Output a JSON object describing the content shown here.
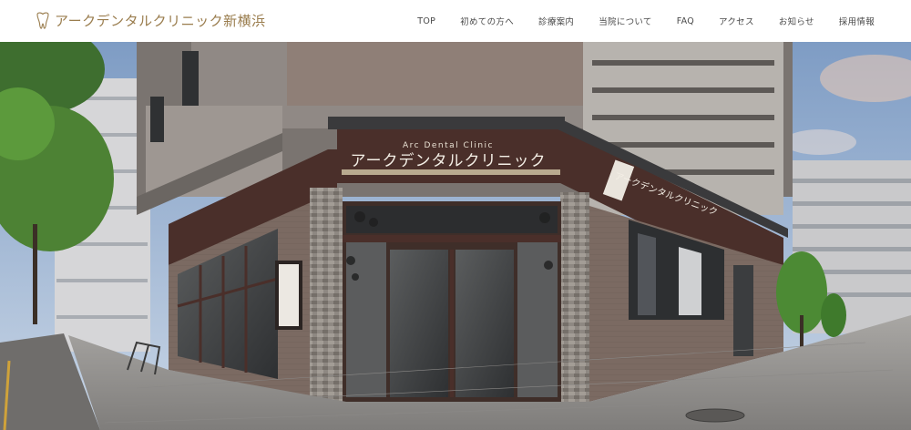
{
  "header": {
    "logo_text": "アークデンタルクリニック新横浜",
    "nav": [
      {
        "id": "top",
        "label": "TOP"
      },
      {
        "id": "first-visit",
        "label": "初めての方へ"
      },
      {
        "id": "treatment",
        "label": "診療案内"
      },
      {
        "id": "about",
        "label": "当院について"
      },
      {
        "id": "faq",
        "label": "FAQ"
      },
      {
        "id": "access",
        "label": "アクセス"
      },
      {
        "id": "news",
        "label": "お知らせ"
      },
      {
        "id": "recruit",
        "label": "採用情報"
      }
    ]
  },
  "hero": {
    "sign_small": "Arc Dental Clinic",
    "sign_main": "アークデンタルクリニック",
    "side_sign_main": "アークデンタルクリニック"
  },
  "colors": {
    "brand_gold": "#9a7d4e",
    "facade_brown": "#4a2f2a",
    "sky": "#8fa9c9"
  }
}
